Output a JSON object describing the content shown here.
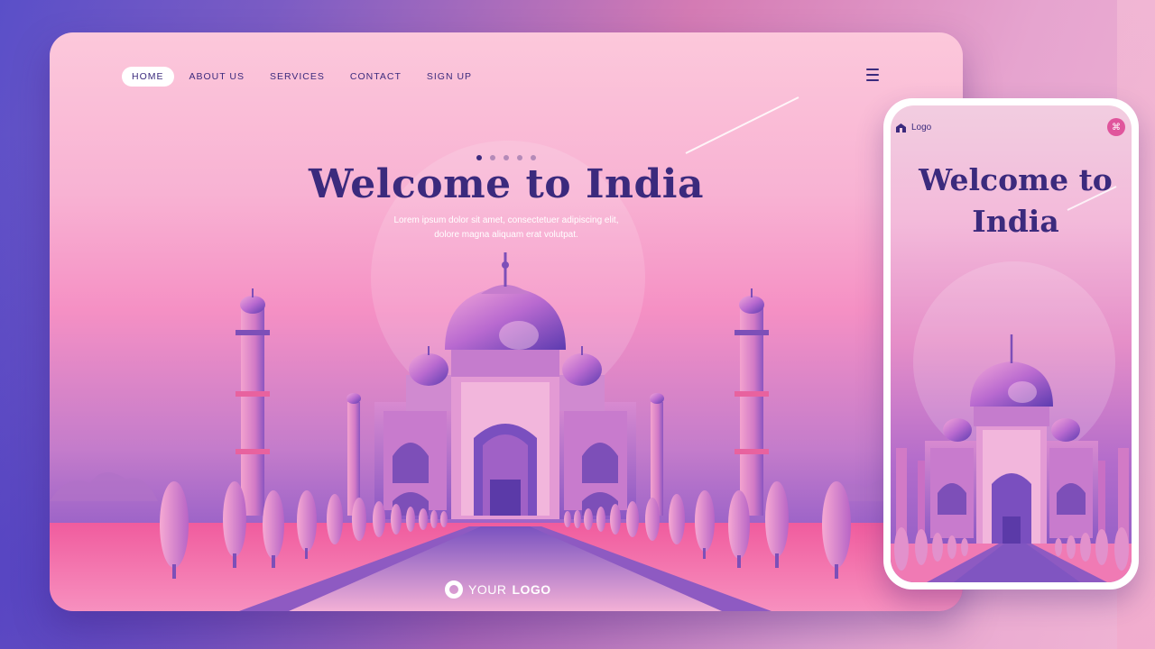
{
  "desktop": {
    "nav": {
      "items": [
        {
          "label": "HOME",
          "active": true
        },
        {
          "label": "ABOUT US",
          "active": false
        },
        {
          "label": "SERVICES",
          "active": false
        },
        {
          "label": "CONTACT",
          "active": false
        },
        {
          "label": "SIGN UP",
          "active": false
        }
      ],
      "menu_icon": "hamburger-icon"
    },
    "carousel": {
      "count": 5,
      "active_index": 0
    },
    "hero": {
      "title": "Welcome to India",
      "subtitle_line1": "Lorem ipsum dolor sit amet, consectetuer adipiscing elit,",
      "subtitle_line2": "dolore magna aliquam erat volutpat."
    },
    "brand": {
      "prefix": "YOUR",
      "strong": "LOGO",
      "icon": "ring-icon"
    }
  },
  "mobile": {
    "logo_label": "Logo",
    "logo_icon": "home-icon",
    "menu_icon": "command-icon",
    "title": "Welcome to India"
  },
  "colors": {
    "primary": "#3b2a7d",
    "accent": "#e0559c",
    "sky_top": "#fcc8db",
    "sky_mid": "#f590c4",
    "sky_bottom": "#9a62c8"
  }
}
